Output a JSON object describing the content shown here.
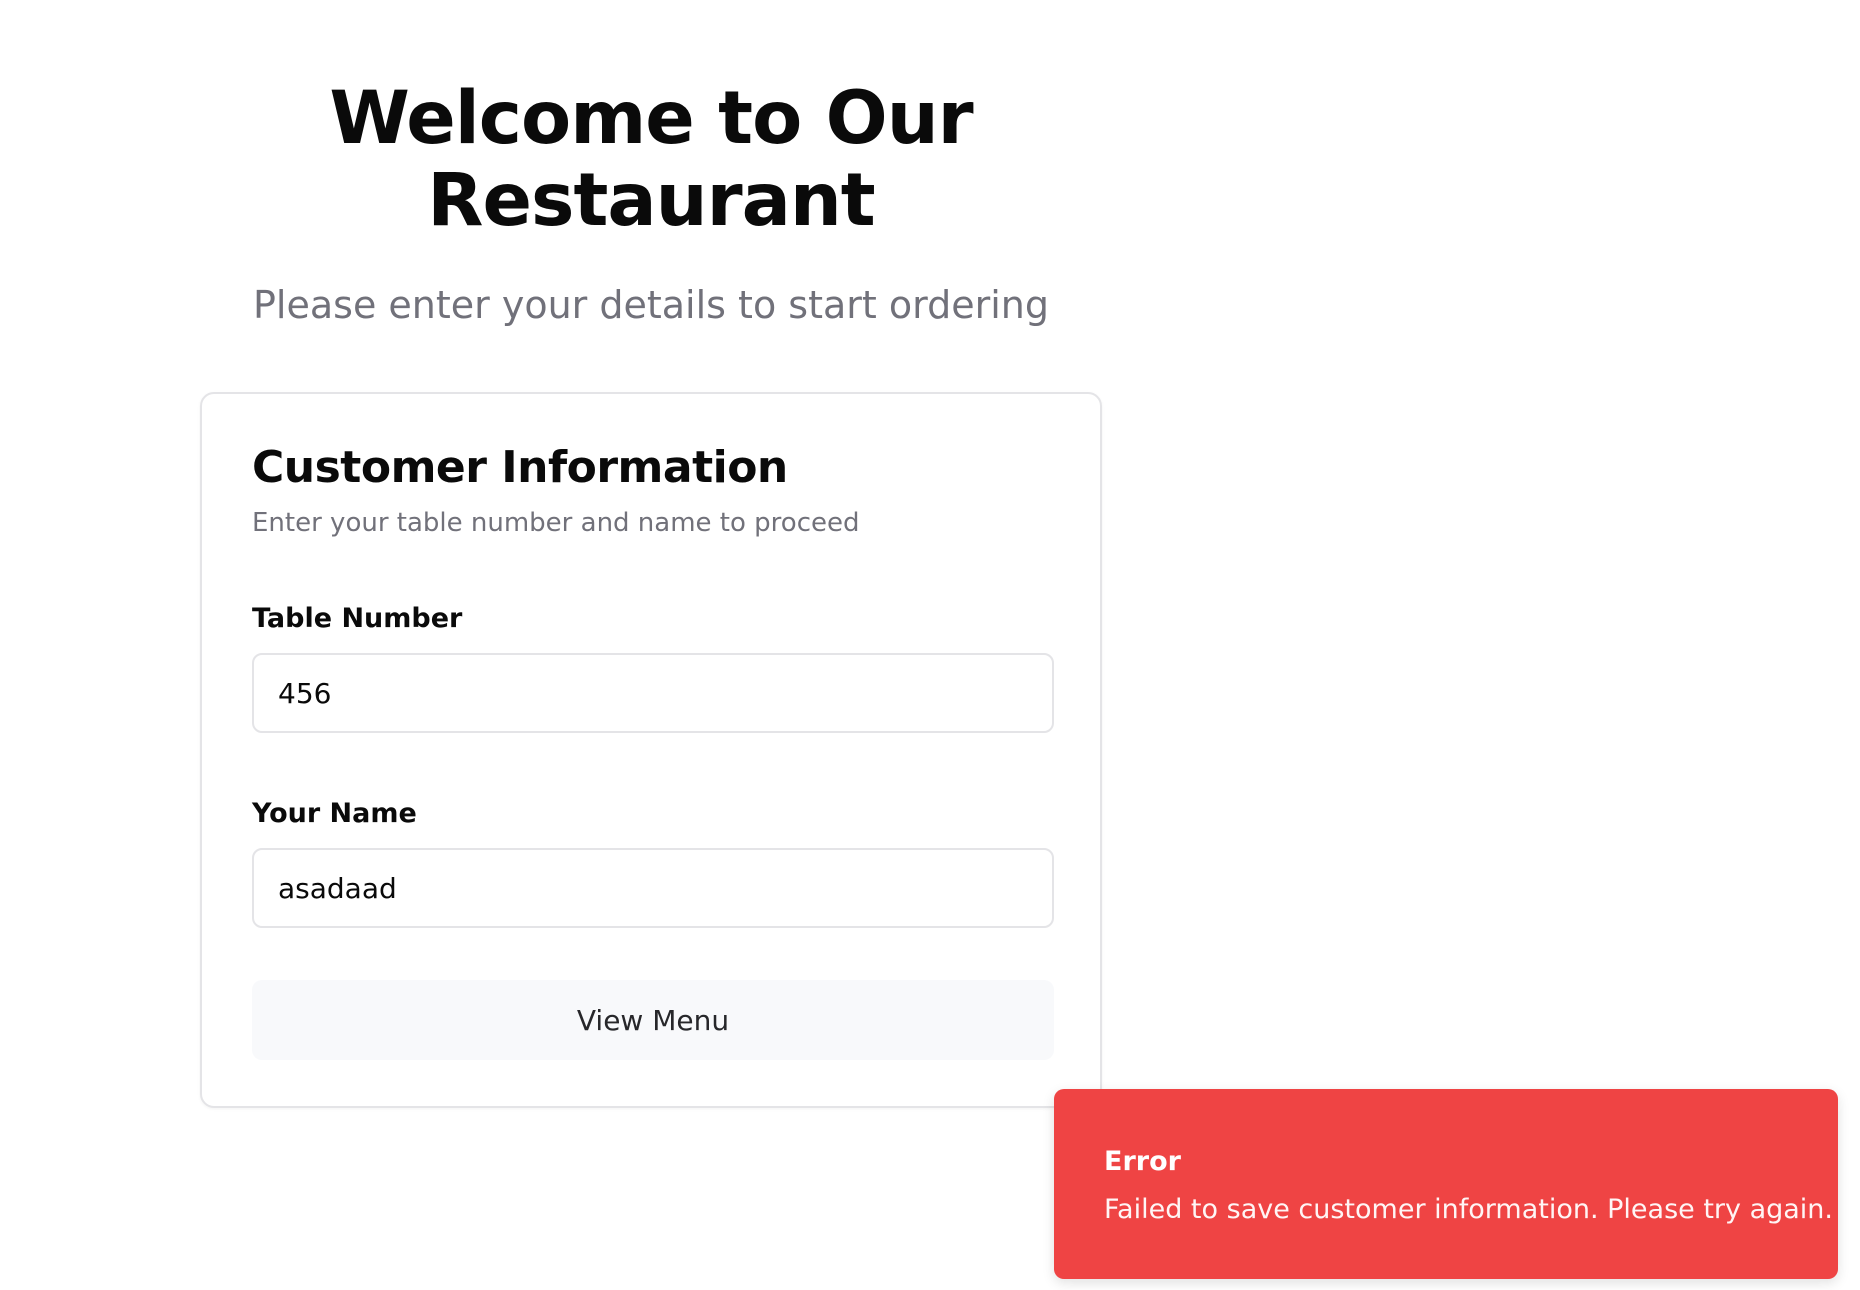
{
  "hero": {
    "title_line1": "Welcome to Our",
    "title_line2": "Restaurant",
    "subtitle": "Please enter your details to start ordering"
  },
  "card": {
    "title": "Customer Information",
    "description": "Enter your table number and name to proceed",
    "table_number": {
      "label": "Table Number",
      "value": "456"
    },
    "name": {
      "label": "Your Name",
      "value": "asadaad"
    },
    "submit_label": "View Menu"
  },
  "toast": {
    "title": "Error",
    "message": "Failed to save customer information. Please try again.",
    "color": "#ef4444"
  }
}
